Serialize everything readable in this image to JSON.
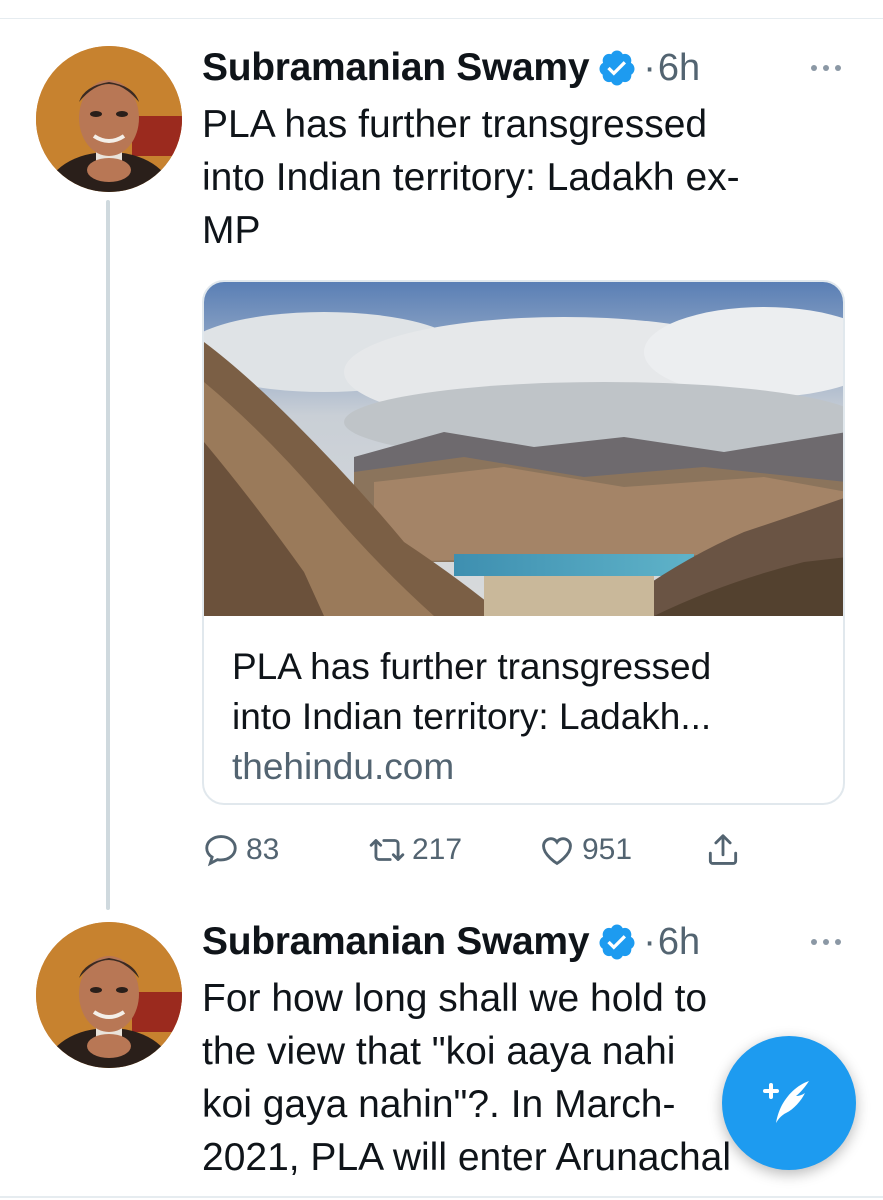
{
  "colors": {
    "accent": "#1d9bf0",
    "text_primary": "#0f1419",
    "text_secondary": "#536471",
    "divider": "#e6ecf0"
  },
  "tweets": [
    {
      "author": "Subramanian Swamy",
      "separator": "·",
      "time": "6h",
      "text": "PLA has further transgressed\ninto Indian territory: Ladakh ex-\nMP",
      "card": {
        "title": "PLA has further transgressed\ninto Indian territory: Ladakh...",
        "domain": "thehindu.com"
      },
      "actions": {
        "replies": "83",
        "retweets": "217",
        "likes": "951"
      }
    },
    {
      "author": "Subramanian Swamy",
      "separator": "·",
      "time": "6h",
      "text": "For how long shall we hold to\nthe view that \"koi aaya nahi\nkoi gaya nahin\"?. In March-\n2021, PLA will enter Arunachal"
    }
  ],
  "icons": {
    "verified": "verified-badge-icon",
    "more": "more-icon",
    "reply": "reply-icon",
    "retweet": "retweet-icon",
    "like": "heart-icon",
    "share": "share-icon",
    "compose": "compose-tweet-icon"
  }
}
